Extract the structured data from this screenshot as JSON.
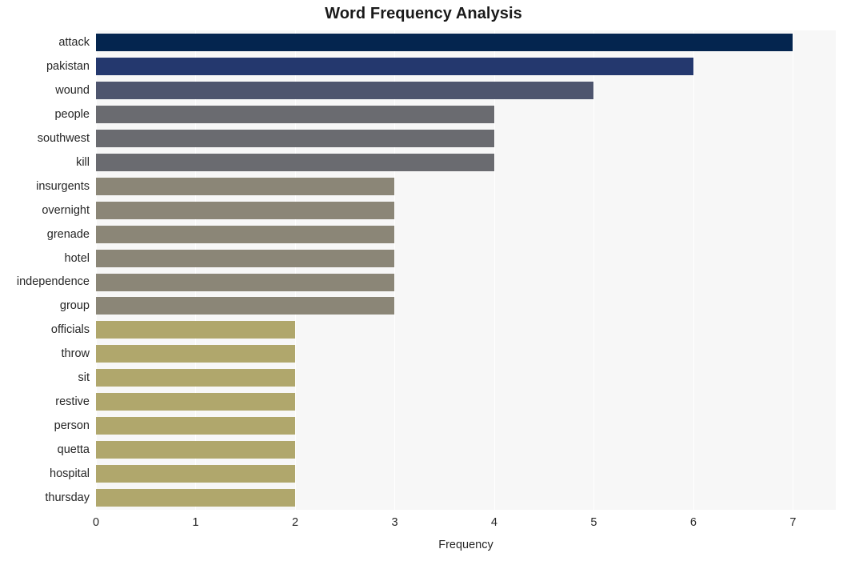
{
  "chart_data": {
    "type": "bar",
    "orientation": "horizontal",
    "title": "Word Frequency Analysis",
    "xlabel": "Frequency",
    "ylabel": "",
    "xlim": [
      0,
      7.43
    ],
    "xticks": [
      "0",
      "1",
      "2",
      "3",
      "4",
      "5",
      "6",
      "7"
    ],
    "grid": true,
    "legend": false,
    "categories": [
      "attack",
      "pakistan",
      "wound",
      "people",
      "southwest",
      "kill",
      "insurgents",
      "overnight",
      "grenade",
      "hotel",
      "independence",
      "group",
      "officials",
      "throw",
      "sit",
      "restive",
      "person",
      "quetta",
      "hospital",
      "thursday"
    ],
    "values": [
      7,
      6,
      5,
      4,
      4,
      4,
      3,
      3,
      3,
      3,
      3,
      3,
      2,
      2,
      2,
      2,
      2,
      2,
      2,
      2
    ],
    "bar_colors": [
      "#04254f",
      "#24386e",
      "#4e556e",
      "#6a6b70",
      "#6a6b70",
      "#6a6b70",
      "#8b8677",
      "#8b8677",
      "#8b8677",
      "#8b8677",
      "#8b8677",
      "#8b8677",
      "#b0a76c",
      "#b0a76c",
      "#b0a76c",
      "#b0a76c",
      "#b0a76c",
      "#b0a76c",
      "#b0a76c",
      "#b0a76c"
    ],
    "plot_background": "#f7f7f7",
    "gridline_color": "#ffffff",
    "figure_background": "#ffffff"
  }
}
